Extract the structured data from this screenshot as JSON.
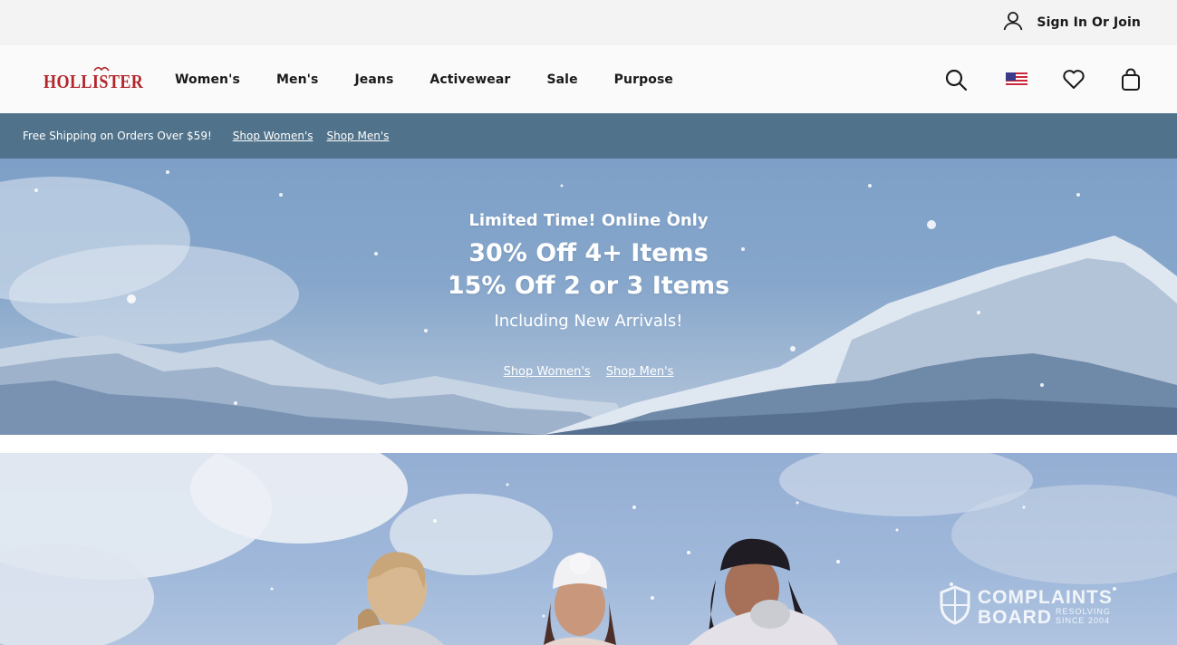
{
  "utility": {
    "sign_in_label": "Sign In Or Join",
    "icon": "user-icon"
  },
  "header": {
    "logo_text": "HOLLISTER",
    "logo_color": "#b1252b",
    "nav": [
      {
        "label": "Women's"
      },
      {
        "label": "Men's"
      },
      {
        "label": "Jeans"
      },
      {
        "label": "Activewear"
      },
      {
        "label": "Sale"
      },
      {
        "label": "Purpose"
      }
    ],
    "icons": [
      "search-icon",
      "us-flag-icon",
      "heart-icon",
      "bag-icon"
    ]
  },
  "promo_strip": {
    "message": "Free Shipping on Orders Over $59!",
    "links": [
      "Shop Women's",
      "Shop Men's"
    ],
    "background": "#50728a"
  },
  "hero": {
    "eyebrow": "Limited Time! Online Only",
    "headline_1": "30% Off 4+ Items",
    "headline_2": "15% Off 2 or 3 Items",
    "subheadline": "Including New Arrivals!",
    "links": [
      "Shop Women's",
      "Shop Men's"
    ]
  },
  "watermark": {
    "line1": "COMPLAINTS",
    "line2": "BOARD",
    "side1": "RESOLVING",
    "side2": "SINCE 2004"
  }
}
